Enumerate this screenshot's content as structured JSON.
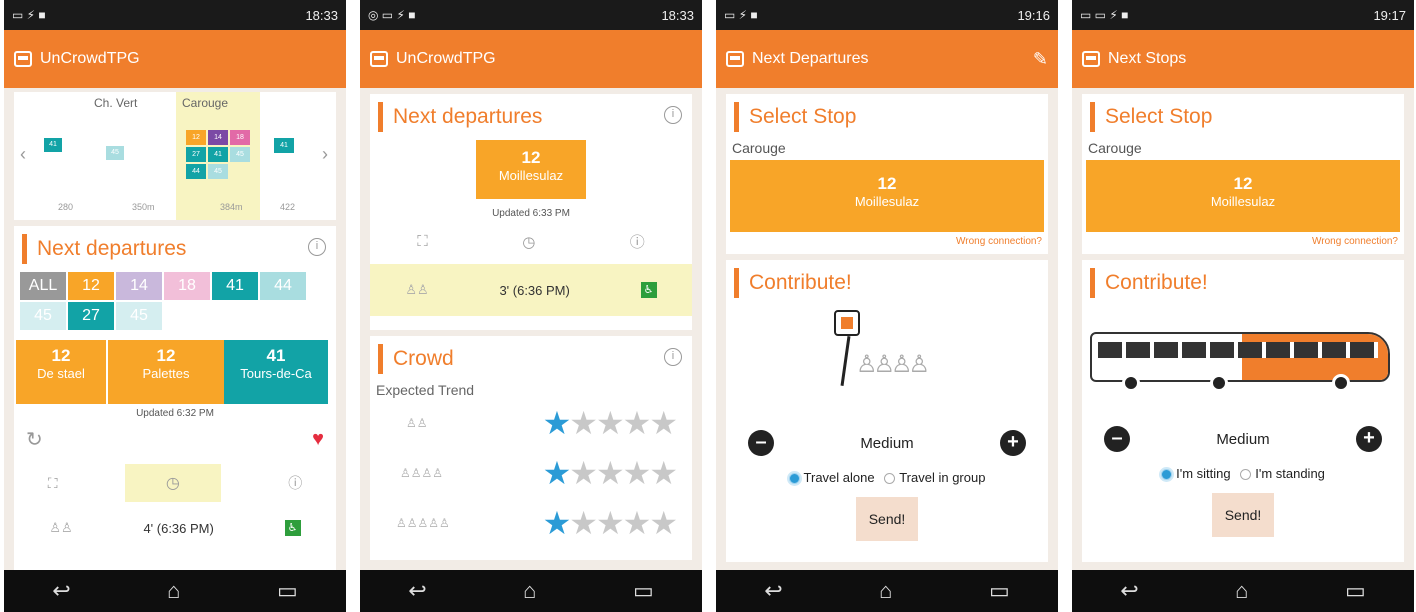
{
  "colors": {
    "accent": "#f07e2c",
    "box_orange": "#f8a528",
    "teal": "#12a3a6",
    "star_active": "#2b9bd6",
    "highlight": "#f8f4c2"
  },
  "screens": [
    {
      "time": "18:33",
      "app_title": "UnCrowdTPG",
      "stops": {
        "left": "Ch. Vert",
        "center": "Carouge",
        "dist": [
          "280",
          "350m",
          "384m",
          "422"
        ],
        "lines_left": [
          "41"
        ],
        "lines_mid": [
          "45"
        ],
        "lines_center": [
          "12",
          "14",
          "18",
          "27",
          "41",
          "45",
          "44",
          "45"
        ],
        "lines_right": [
          "41"
        ]
      },
      "next_title": "Next departures",
      "filters": [
        "ALL",
        "12",
        "14",
        "18",
        "41",
        "44",
        "45",
        "27",
        "45"
      ],
      "departures": [
        {
          "line": "12",
          "dest": "De stael"
        },
        {
          "line": "12",
          "dest": "Palettes"
        },
        {
          "line": "41",
          "dest": "Tours-de-Ca"
        }
      ],
      "updated": "Updated 6:32 PM",
      "row_time": "4' (6:36 PM)"
    },
    {
      "time": "18:33",
      "app_title": "UnCrowdTPG",
      "next_title": "Next departures",
      "selected": {
        "line": "12",
        "dest": "Moillesulaz"
      },
      "updated": "Updated 6:33 PM",
      "row_time": "3' (6:36 PM)",
      "crowd_title": "Crowd",
      "crowd_subtitle": "Expected Trend",
      "ratings": [
        1,
        1,
        1
      ]
    },
    {
      "time": "19:16",
      "app_title": "Next Departures",
      "select_title": "Select Stop",
      "stop_name": "Carouge",
      "selected": {
        "line": "12",
        "dest": "Moillesulaz"
      },
      "wrong": "Wrong connection?",
      "contribute": "Contribute!",
      "level": "Medium",
      "radio": [
        "Travel alone",
        "Travel in group"
      ],
      "send": "Send!"
    },
    {
      "time": "19:17",
      "app_title": "Next Stops",
      "select_title": "Select Stop",
      "stop_name": "Carouge",
      "selected": {
        "line": "12",
        "dest": "Moillesulaz"
      },
      "wrong": "Wrong connection?",
      "contribute": "Contribute!",
      "level": "Medium",
      "radio": [
        "I'm sitting",
        "I'm standing"
      ],
      "send": "Send!"
    }
  ]
}
